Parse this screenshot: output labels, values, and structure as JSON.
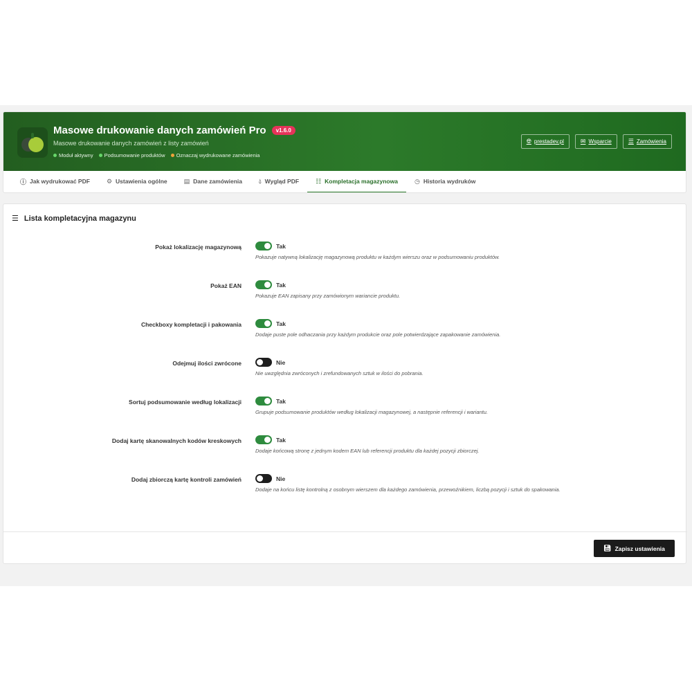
{
  "header": {
    "title": "Masowe drukowanie danych zamówień Pro",
    "version": "v1.6.0",
    "subtitle": "Masowe drukowanie danych zamówień z listy zamówień",
    "status": [
      {
        "label": "Moduł aktywny",
        "color": "#67d66a"
      },
      {
        "label": "Podsumowanie produktów",
        "color": "#67d66a"
      },
      {
        "label": "Oznaczaj wydrukowane zamówienia",
        "color": "#f0a23a"
      }
    ],
    "links": [
      {
        "label": "prestadev.pl",
        "icon": "globe-icon"
      },
      {
        "label": "Wsparcie",
        "icon": "envelope-icon"
      },
      {
        "label": "Zamówienia",
        "icon": "list-icon"
      }
    ]
  },
  "tabs": [
    {
      "label": "Jak wydrukować PDF",
      "icon": "info-icon",
      "active": false
    },
    {
      "label": "Ustawienia ogólne",
      "icon": "cogs-icon",
      "active": false
    },
    {
      "label": "Dane zamówienia",
      "icon": "table-icon",
      "active": false
    },
    {
      "label": "Wygląd PDF",
      "icon": "drop-icon",
      "active": false
    },
    {
      "label": "Kompletacja magazynowa",
      "icon": "checklist-icon",
      "active": true
    },
    {
      "label": "Historia wydruków",
      "icon": "clock-icon",
      "active": false
    }
  ],
  "panel": {
    "title": "Lista kompletacyjna magazynu",
    "settings": [
      {
        "label": "Pokaż lokalizację magazynową",
        "value": "Tak",
        "on": true,
        "help": "Pokazuje natywną lokalizację magazynową produktu w każdym wierszu oraz w podsumowaniu produktów."
      },
      {
        "label": "Pokaż EAN",
        "value": "Tak",
        "on": true,
        "help": "Pokazuje EAN zapisany przy zamówionym wariancie produktu."
      },
      {
        "label": "Checkboxy kompletacji i pakowania",
        "value": "Tak",
        "on": true,
        "help": "Dodaje puste pole odhaczania przy każdym produkcie oraz pole potwierdzające zapakowanie zamówienia."
      },
      {
        "label": "Odejmuj ilości zwrócone",
        "value": "Nie",
        "on": false,
        "help": "Nie uwzględnia zwróconych i zrefundowanych sztuk w ilości do pobrania."
      },
      {
        "label": "Sortuj podsumowanie według lokalizacji",
        "value": "Tak",
        "on": true,
        "help": "Grupuje podsumowanie produktów według lokalizacji magazynowej, a następnie referencji i wariantu."
      },
      {
        "label": "Dodaj kartę skanowalnych kodów kreskowych",
        "value": "Tak",
        "on": true,
        "help": "Dodaje końcową stronę z jednym kodem EAN lub referencji produktu dla każdej pozycji zbiorczej."
      },
      {
        "label": "Dodaj zbiorczą kartę kontroli zamówień",
        "value": "Nie",
        "on": false,
        "help": "Dodaje na końcu listę kontrolną z osobnym wierszem dla każdego zamówienia, przewoźnikiem, liczbą pozycji i sztuk do spakowania."
      }
    ],
    "save_label": "Zapisz ustawienia"
  },
  "colors": {
    "accent": "#2a7a2a",
    "toggle_on": "#2e8b3e",
    "toggle_off": "#1e1e1e",
    "badge": "#e6335a"
  }
}
